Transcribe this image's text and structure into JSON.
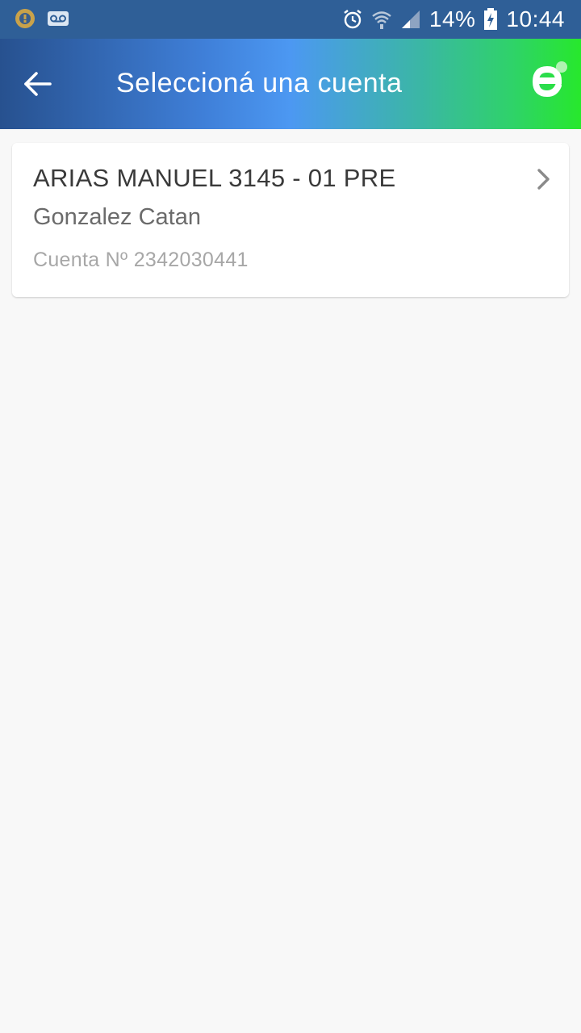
{
  "status_bar": {
    "battery_percent": "14%",
    "time": "10:44",
    "icons": [
      "notification-coin-icon",
      "voicemail-icon",
      "alarm-icon",
      "wifi-icon",
      "signal-icon",
      "battery-charging-icon"
    ]
  },
  "app_bar": {
    "title": "Seleccioná una cuenta",
    "back_icon": "arrow-left-icon",
    "logo_icon": "brand-e-logo-icon",
    "gradient_colors": [
      "#27518f",
      "#4c98f2",
      "#27e82c"
    ]
  },
  "accounts": [
    {
      "name": "ARIAS MANUEL 3145 - 01 PRE",
      "location": "Gonzalez Catan",
      "number": "Cuenta Nº 2342030441"
    }
  ]
}
